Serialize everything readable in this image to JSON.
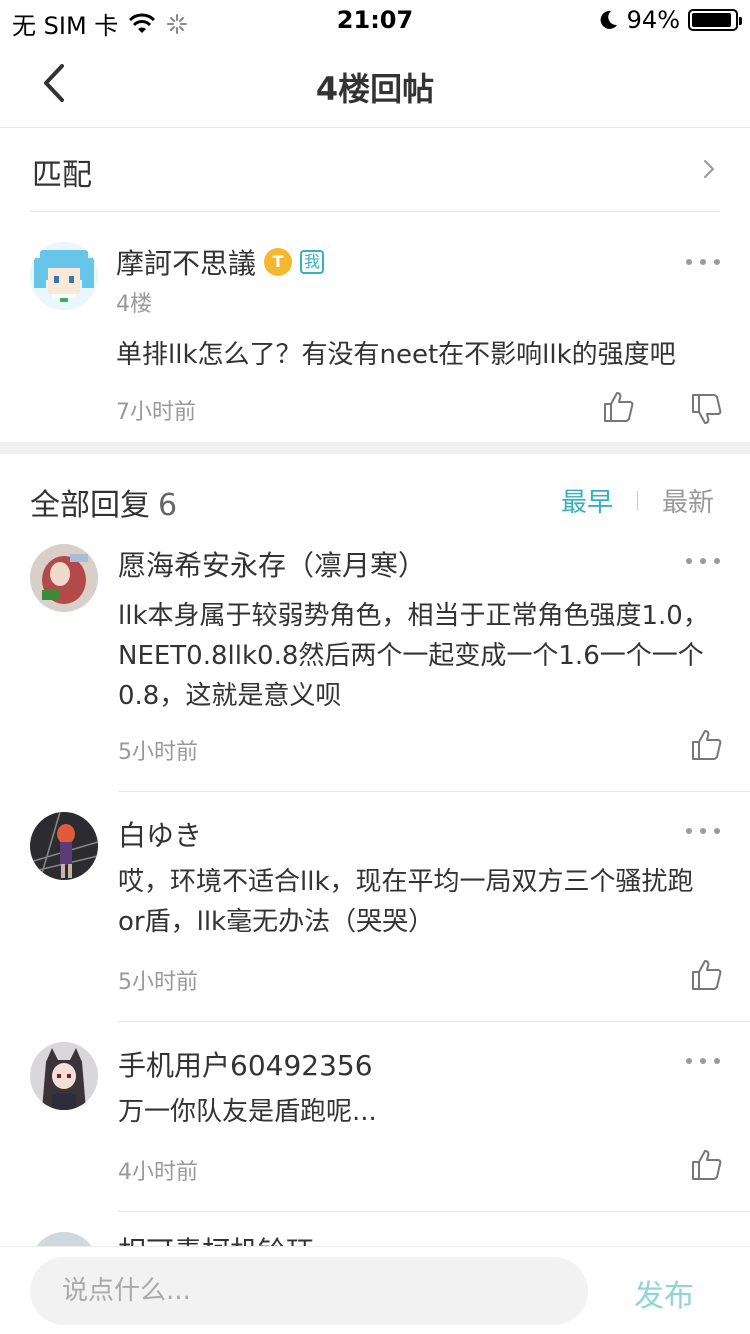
{
  "status_bar": {
    "carrier": "无 SIM 卡",
    "time": "21:07",
    "battery_percent_label": "94%",
    "battery_level": 0.94
  },
  "nav": {
    "title": "4楼回帖"
  },
  "match_row": {
    "label": "匹配"
  },
  "main_post": {
    "author": "摩訶不思議",
    "level_badge": "T",
    "me_badge": "我",
    "floor": "4楼",
    "content": "单排llk怎么了？有没有neet在不影响llk的强度吧",
    "time": "7小时前"
  },
  "replies_header": {
    "title": "全部回复",
    "count": "6",
    "sort_earliest": "最早",
    "sort_latest": "最新"
  },
  "replies": [
    {
      "author": "愿海希安永存（凛月寒）",
      "content": "llk本身属于较弱势角色，相当于正常角色强度1.0，NEET0.8llk0.8然后两个一起变成一个1.6一个一个0.8，这就是意义呗",
      "time": "5小时前"
    },
    {
      "author": "白ゆき",
      "content": "哎，环境不适合llk，现在平均一局双方三个骚扰跑or盾，llk毫无办法（哭哭）",
      "time": "5小时前"
    },
    {
      "author": "手机用户60492356",
      "content": "万一你队友是盾跑呢...",
      "time": "4小时前"
    },
    {
      "author": "相可青柯机铃珏"
    }
  ],
  "input_bar": {
    "placeholder": "说点什么...",
    "publish_label": "发布"
  },
  "colors": {
    "accent": "#34b0c0",
    "publish_disabled": "#8fd3db",
    "level_badge": "#f4b72d"
  }
}
